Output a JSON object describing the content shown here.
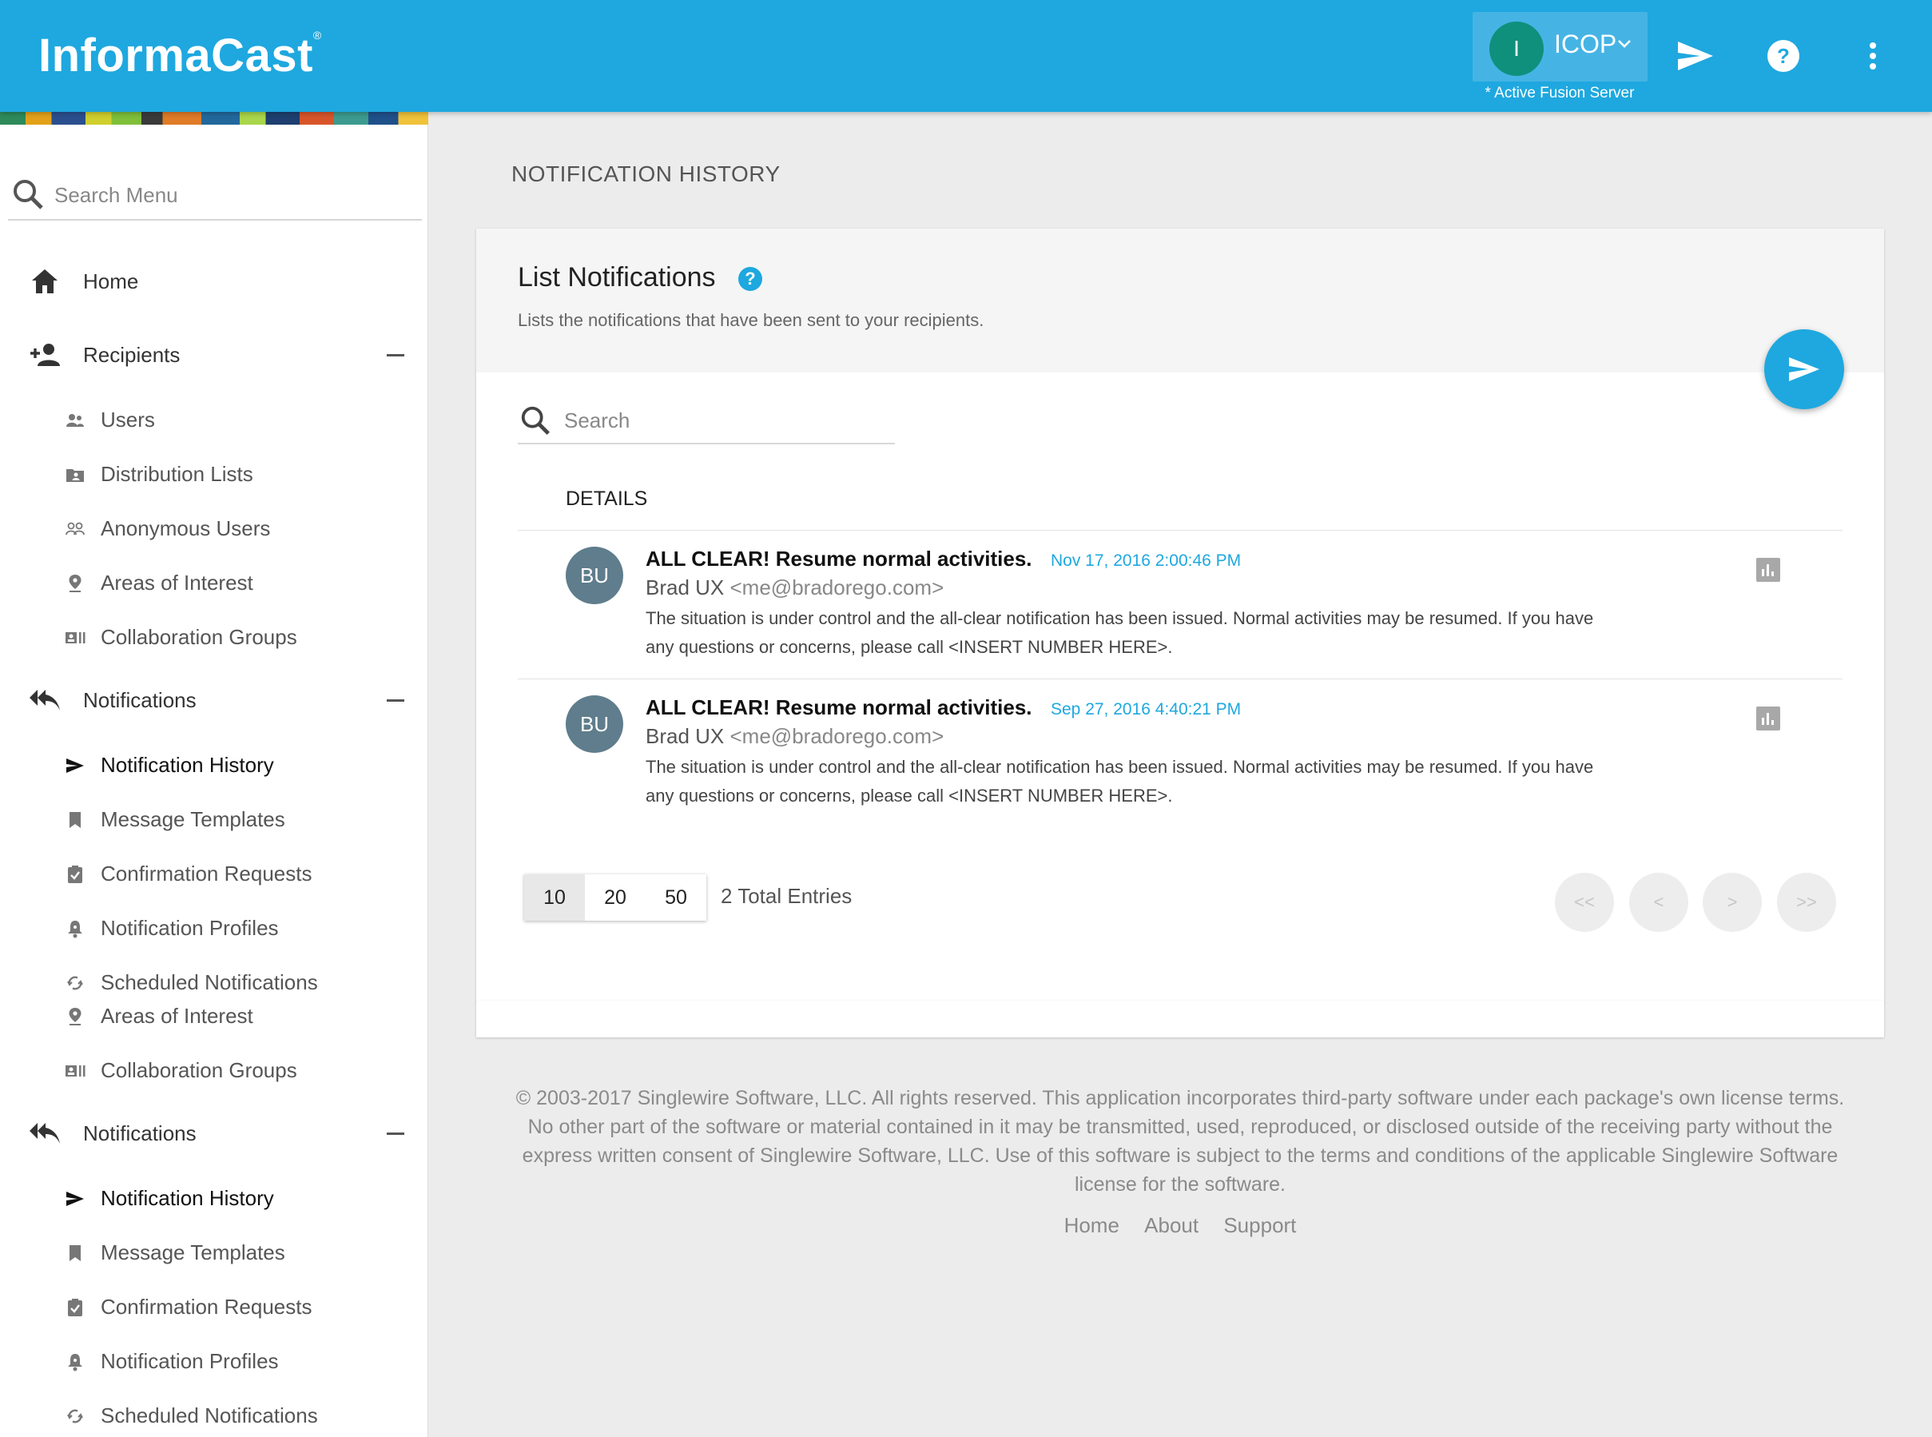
{
  "header": {
    "brand": "InformaCast",
    "brand_mark": "®",
    "server_initial": "I",
    "server_name": "ICOP",
    "server_note": "* Active Fusion Server",
    "icons": [
      "send-icon",
      "help-icon",
      "more-vert-icon"
    ],
    "accent_color": "#1ea8df"
  },
  "sidebar": {
    "search_placeholder": "Search Menu",
    "sections": [
      {
        "label": "Home",
        "icon": "home-icon"
      },
      {
        "label": "Recipients",
        "icon": "person-add-icon",
        "items": [
          {
            "label": "Users",
            "icon": "users-icon"
          },
          {
            "label": "Distribution Lists",
            "icon": "folder-contact-icon"
          },
          {
            "label": "Anonymous Users",
            "icon": "anonymous-users-icon"
          },
          {
            "label": "Areas of Interest",
            "icon": "location-pin-icon"
          },
          {
            "label": "Collaboration Groups",
            "icon": "collaboration-icon"
          }
        ]
      },
      {
        "label": "Notifications",
        "icon": "reply-all-icon",
        "items": [
          {
            "label": "Notification History",
            "icon": "send-icon"
          },
          {
            "label": "Message Templates",
            "icon": "bookmark-icon"
          },
          {
            "label": "Confirmation Requests",
            "icon": "clipboard-check-icon"
          },
          {
            "label": "Notification Profiles",
            "icon": "bell-profile-icon"
          },
          {
            "label": "Scheduled Notifications",
            "icon": "schedule-sync-icon"
          },
          {
            "label": "Areas of Interest",
            "icon": "location-pin-icon"
          },
          {
            "label": "Collaboration Groups",
            "icon": "collaboration-icon"
          }
        ]
      },
      {
        "label": "Notifications",
        "icon": "reply-all-icon",
        "items": [
          {
            "label": "Notification History",
            "icon": "send-icon"
          },
          {
            "label": "Message Templates",
            "icon": "bookmark-icon"
          },
          {
            "label": "Confirmation Requests",
            "icon": "clipboard-check-icon"
          },
          {
            "label": "Notification Profiles",
            "icon": "bell-profile-icon"
          },
          {
            "label": "Scheduled Notifications",
            "icon": "schedule-sync-icon"
          }
        ]
      }
    ]
  },
  "main": {
    "page_title": "NOTIFICATION HISTORY",
    "card_title": "List Notifications",
    "help_glyph": "?",
    "card_subtitle": "Lists the notifications that have been sent to your recipients.",
    "search_placeholder": "Search",
    "column_header": "DETAILS",
    "notifications": [
      {
        "initials": "BU",
        "subject": "ALL CLEAR! Resume normal activities.",
        "timestamp": "Nov 17, 2016 2:00:46 PM",
        "sender_name": "Brad UX",
        "sender_email": "<me@bradorego.com>",
        "body_line1": "The situation is under control and the all-clear notification has been issued. Normal activities may be resumed. If you have",
        "body_line2": "any questions or concerns, please call <INSERT NUMBER HERE>."
      },
      {
        "initials": "BU",
        "subject": "ALL CLEAR! Resume normal activities.",
        "timestamp": "Sep 27, 2016 4:40:21 PM",
        "sender_name": "Brad UX",
        "sender_email": "<me@bradorego.com>",
        "body_line1": "The situation is under control and the all-clear notification has been issued. Normal activities may be resumed. If you have",
        "body_line2": "any questions or concerns, please call <INSERT NUMBER HERE>."
      }
    ],
    "page_sizes": [
      "10",
      "20",
      "50"
    ],
    "selected_page_size": "10",
    "total_entries": "2 Total Entries",
    "pager": {
      "first": "<<",
      "prev": "<",
      "next": ">",
      "last": ">>"
    }
  },
  "footer": {
    "copyright_lines": [
      "© 2003-2017 Singlewire Software, LLC. All rights reserved. This application incorporates third-party software under each package's own license terms.",
      "No other part of the software or material contained in it may be transmitted, used, reproduced, or disclosed outside of the receiving party without the",
      "express written consent of Singlewire Software, LLC. Use of this software is subject to the terms and conditions of the applicable Singlewire Software",
      "license for the software."
    ],
    "links": [
      "Home",
      "About",
      "Support"
    ]
  }
}
